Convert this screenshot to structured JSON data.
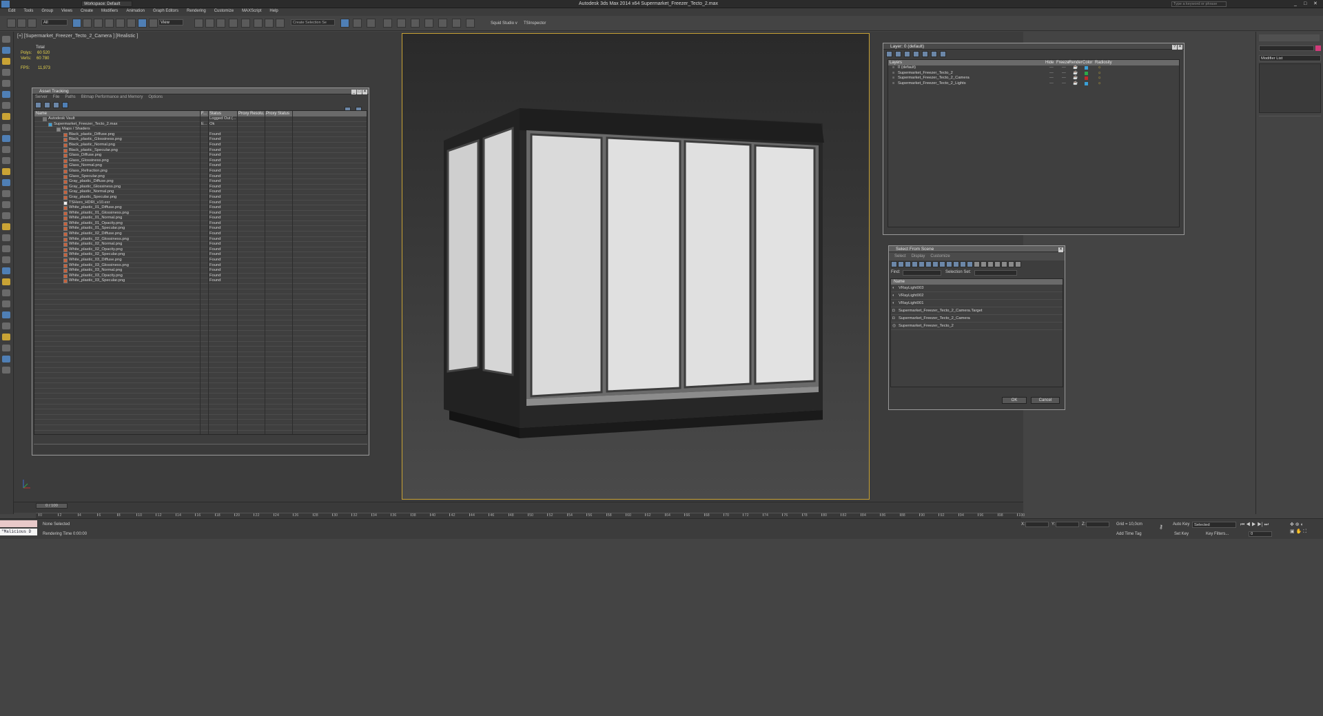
{
  "app": {
    "title": "Autodesk 3ds Max 2014 x64     Supermarket_Freezer_Tecto_2.max",
    "workspace": "Workspace: Default",
    "search_placeholder": "Type a keyword or phrase"
  },
  "menu": [
    "Edit",
    "Tools",
    "Group",
    "Views",
    "Create",
    "Modifiers",
    "Animation",
    "Graph Editors",
    "Rendering",
    "Customize",
    "MAXScript",
    "Help"
  ],
  "toolbar": {
    "filter": "All",
    "refcoord": "View",
    "selection_set_placeholder": "Create Selection Se",
    "squid": "Squid Studio v",
    "tsinspector": "TSInspector"
  },
  "viewport": {
    "label": "[+] [Supermarket_Freezer_Tecto_2_Camera ] [Realistic ]",
    "stats": {
      "total_label": "Total",
      "polys_label": "Polys:",
      "polys": "60 520",
      "verts_label": "Verts:",
      "verts": "60 780",
      "fps_label": "FPS:",
      "fps": "11,973"
    }
  },
  "asset_tracking": {
    "title": "Asset Tracking",
    "menu": [
      "Server",
      "File",
      "Paths",
      "Bitmap Performance and Memory",
      "Options"
    ],
    "columns": [
      "Name",
      "F...",
      "Status",
      "Proxy Resolu...",
      "Proxy Status"
    ],
    "root": {
      "name": "Autodesk Vault",
      "status": "Logged Out (..."
    },
    "file": {
      "name": "Supermarket_Freezer_Tecto_2.max",
      "f": "E...",
      "status": "Ok"
    },
    "group": "Maps / Shaders",
    "items": [
      {
        "name": "Black_plastic_Diffuse.png",
        "status": "Found"
      },
      {
        "name": "Black_plastic_Glossiness.png",
        "status": "Found"
      },
      {
        "name": "Black_plastic_Normal.png",
        "status": "Found"
      },
      {
        "name": "Black_plastic_Specular.png",
        "status": "Found"
      },
      {
        "name": "Glass_Diffuse.png",
        "status": "Found"
      },
      {
        "name": "Glass_Glossiness.png",
        "status": "Found"
      },
      {
        "name": "Glass_Normal.png",
        "status": "Found"
      },
      {
        "name": "Glass_Refraction.png",
        "status": "Found"
      },
      {
        "name": "Glass_Specular.png",
        "status": "Found"
      },
      {
        "name": "Gray_plastic_Diffuse.png",
        "status": "Found"
      },
      {
        "name": "Gray_plastic_Glossiness.png",
        "status": "Found"
      },
      {
        "name": "Gray_plastic_Normal.png",
        "status": "Found"
      },
      {
        "name": "Gray_plastic_Specular.png",
        "status": "Found"
      },
      {
        "name": "TSHero_HDRI_v10.exr",
        "status": "Found"
      },
      {
        "name": "White_plastic_01_Diffuse.png",
        "status": "Found"
      },
      {
        "name": "White_plastic_01_Glossiness.png",
        "status": "Found"
      },
      {
        "name": "White_plastic_01_Normal.png",
        "status": "Found"
      },
      {
        "name": "White_plastic_01_Opacity.png",
        "status": "Found"
      },
      {
        "name": "White_plastic_01_Specular.png",
        "status": "Found"
      },
      {
        "name": "White_plastic_02_Diffuse.png",
        "status": "Found"
      },
      {
        "name": "White_plastic_02_Glossiness.png",
        "status": "Found"
      },
      {
        "name": "White_plastic_02_Normal.png",
        "status": "Found"
      },
      {
        "name": "White_plastic_02_Opacity.png",
        "status": "Found"
      },
      {
        "name": "White_plastic_02_Specular.png",
        "status": "Found"
      },
      {
        "name": "White_plastic_03_Diffuse.png",
        "status": "Found"
      },
      {
        "name": "White_plastic_03_Glossiness.png",
        "status": "Found"
      },
      {
        "name": "White_plastic_03_Normal.png",
        "status": "Found"
      },
      {
        "name": "White_plastic_03_Opacity.png",
        "status": "Found"
      },
      {
        "name": "White_plastic_03_Specular.png",
        "status": "Found"
      }
    ]
  },
  "layer_manager": {
    "title": "Layer: 0 (default)",
    "columns": [
      "Layers",
      "Hide",
      "Freeze",
      "Render",
      "Color",
      "Radiosity"
    ],
    "rows": [
      "0 (default)",
      "Supermarket_Freezer_Tecto_2",
      "Supermarket_Freezer_Tecto_2_Camera",
      "Supermarket_Freezer_Tecto_2_Lights"
    ],
    "colors": [
      "#3aa0d8",
      "#2ca84a",
      "#c0282a",
      "#3aa0d8"
    ]
  },
  "select_scene": {
    "title": "Select From Scene",
    "menu": [
      "Select",
      "Display",
      "Customize"
    ],
    "find_label": "Find:",
    "selection_set_label": "Selection Set:",
    "column": "Name",
    "rows": [
      "VRayLight003",
      "VRayLight002",
      "VRayLight001",
      "Supermarket_Freezer_Tecto_2_Camera.Target",
      "Supermarket_Freezer_Tecto_2_Camera",
      "Supermarket_Freezer_Tecto_2"
    ],
    "ok": "OK",
    "cancel": "Cancel"
  },
  "right_panel": {
    "modifier_list": "Modifier List"
  },
  "timeline": {
    "frame": "0 / 100",
    "ticks": [
      "0",
      "2",
      "4",
      "6",
      "8",
      "10",
      "12",
      "14",
      "16",
      "18",
      "20",
      "22",
      "24",
      "26",
      "28",
      "30",
      "32",
      "34",
      "36",
      "38",
      "40",
      "42",
      "44",
      "46",
      "48",
      "50",
      "52",
      "54",
      "56",
      "58",
      "60",
      "62",
      "64",
      "66",
      "68",
      "70",
      "72",
      "74",
      "76",
      "78",
      "80",
      "82",
      "84",
      "86",
      "88",
      "90",
      "92",
      "94",
      "96",
      "98",
      "100"
    ]
  },
  "status": {
    "maxscript": "\"Malicious D",
    "selection": "None Selected",
    "render_time": "Rendering Time  0:00:00",
    "x_label": "X:",
    "y_label": "Y:",
    "z_label": "Z:",
    "grid": "Grid = 10,0cm",
    "add_time_tag": "Add Time Tag",
    "auto_key": "Auto Key",
    "set_key": "Set Key",
    "selected": "Selected",
    "key_filters": "Key Filters...",
    "frame_value": "0"
  }
}
